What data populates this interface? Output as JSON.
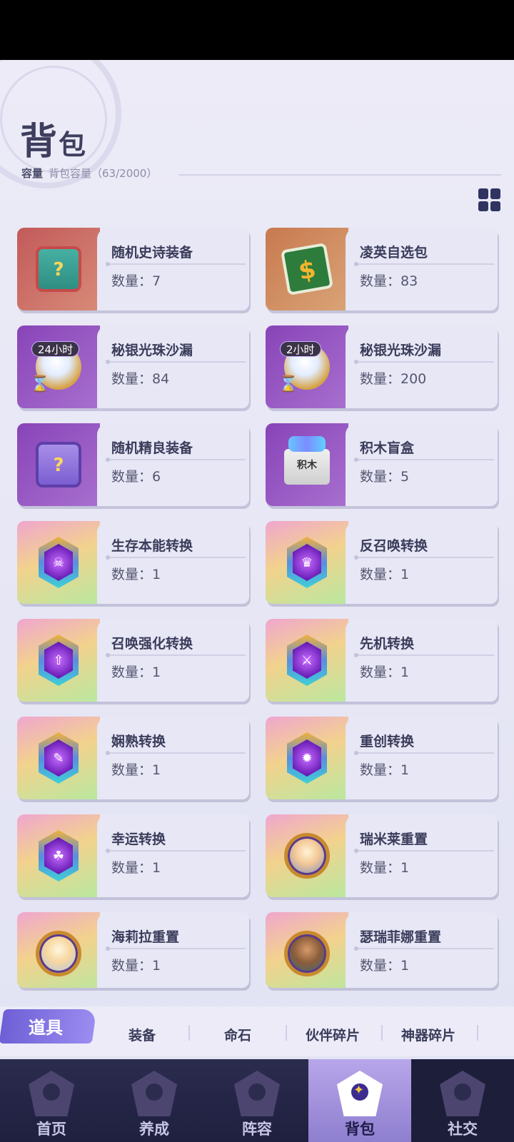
{
  "header": {
    "title_main": "背",
    "title_small": "包",
    "capacity_label": "容量",
    "capacity_text": "背包容量（63/2000）"
  },
  "layout_toggle_icon": "grid-view-icon",
  "items": [
    {
      "name": "随机史诗装备",
      "qty": "数量：7",
      "bg": "red",
      "icon": "epic-chest-icon"
    },
    {
      "name": "凌英自选包",
      "qty": "数量：83",
      "bg": "orange",
      "icon": "select-pack-icon"
    },
    {
      "name": "秘银光珠沙漏",
      "qty": "数量：84",
      "bg": "purple",
      "icon": "hourglass-orb-icon",
      "timer": "24小时"
    },
    {
      "name": "秘银光珠沙漏",
      "qty": "数量：200",
      "bg": "purple",
      "icon": "hourglass-orb-icon",
      "timer": "2小时"
    },
    {
      "name": "随机精良装备",
      "qty": "数量：6",
      "bg": "purple",
      "icon": "fine-chest-icon"
    },
    {
      "name": "积木盲盒",
      "qty": "数量：5",
      "bg": "purple",
      "icon": "blind-box-icon",
      "box_label": "积木"
    },
    {
      "name": "生存本能转换",
      "qty": "数量：1",
      "bg": "rainbow",
      "icon": "convert-hex-icon"
    },
    {
      "name": "反召唤转换",
      "qty": "数量：1",
      "bg": "rainbow",
      "icon": "convert-hex-icon"
    },
    {
      "name": "召唤强化转换",
      "qty": "数量：1",
      "bg": "rainbow",
      "icon": "convert-hex-icon"
    },
    {
      "name": "先机转换",
      "qty": "数量：1",
      "bg": "rainbow",
      "icon": "convert-hex-icon"
    },
    {
      "name": "娴熟转换",
      "qty": "数量：1",
      "bg": "rainbow",
      "icon": "convert-hex-icon"
    },
    {
      "name": "重创转换",
      "qty": "数量：1",
      "bg": "rainbow",
      "icon": "convert-hex-icon"
    },
    {
      "name": "幸运转换",
      "qty": "数量：1",
      "bg": "rainbow",
      "icon": "convert-hex-icon"
    },
    {
      "name": "瑞米莱重置",
      "qty": "数量：1",
      "bg": "rainbow",
      "icon": "portrait-icon"
    },
    {
      "name": "海莉拉重置",
      "qty": "数量：1",
      "bg": "rainbow",
      "icon": "portrait-icon"
    },
    {
      "name": "瑟瑞菲娜重置",
      "qty": "数量：1",
      "bg": "rainbow",
      "icon": "portrait-icon"
    }
  ],
  "category_tabs": {
    "active": "道具",
    "others": [
      "装备",
      "命石",
      "伙伴碎片",
      "神器碎片"
    ]
  },
  "bottom_nav": [
    "首页",
    "养成",
    "阵容",
    "背包",
    "社交"
  ]
}
